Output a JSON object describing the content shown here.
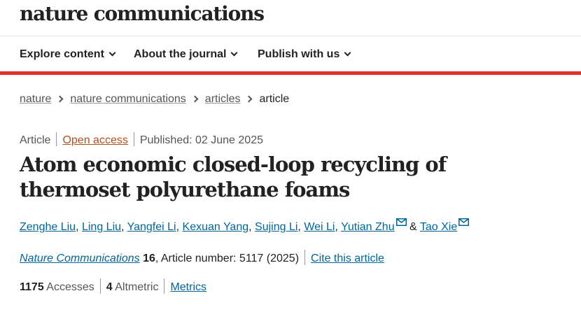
{
  "site": {
    "brand": "nature communications"
  },
  "nav": {
    "items": [
      {
        "label": "Explore content"
      },
      {
        "label": "About the journal"
      },
      {
        "label": "Publish with us"
      }
    ]
  },
  "breadcrumb": {
    "items": [
      "nature",
      "nature communications",
      "articles"
    ],
    "current": "article"
  },
  "article": {
    "type": "Article",
    "access": "Open access",
    "published": "Published: 02 June 2025",
    "title": "Atom economic closed-loop recycling of thermoset polyurethane foams",
    "authors": [
      "Zenghe Liu",
      "Ling Liu",
      "Yangfei Li",
      "Kexuan Yang",
      "Sujing Li",
      "Wei Li",
      "Yutian Zhu",
      "Tao Xie"
    ],
    "author_separator": ",",
    "author_and": "&",
    "journal": "Nature Communications",
    "volume": "16",
    "article_number": ", Article number: 5117 (2025)",
    "cite_label": "Cite this article",
    "accesses_count": "1175",
    "accesses_label": "Accesses",
    "altmetric_count": "4",
    "altmetric_label": "Altmetric",
    "metrics_label": "Metrics"
  },
  "colors": {
    "accent": "#e0322a",
    "link": "#006699",
    "open_access": "#b54f1b"
  },
  "icons": {
    "nav_chevron": "chevron-down-icon",
    "breadcrumb_separator": "chevron-right-icon",
    "corresponding_author": "mail-icon"
  }
}
